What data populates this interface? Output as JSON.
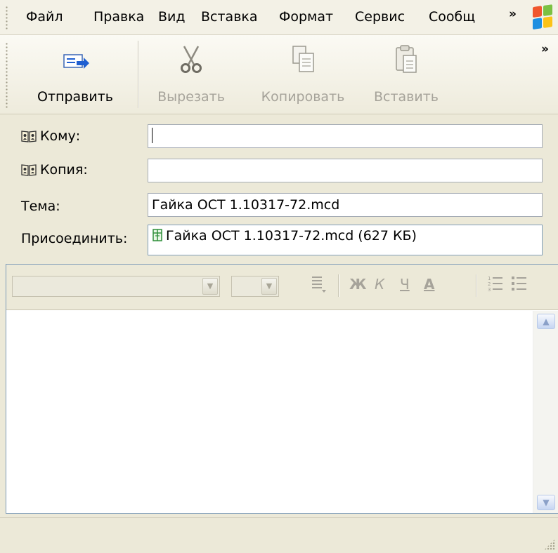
{
  "menu": {
    "items": [
      "Файл",
      "Правка",
      "Вид",
      "Вставка",
      "Формат",
      "Сервис",
      "Сообщ"
    ],
    "more_label": "»"
  },
  "toolbar": {
    "send_label": "Отправить",
    "cut_label": "Вырезать",
    "copy_label": "Копировать",
    "paste_label": "Вставить",
    "more_label": "»"
  },
  "header": {
    "to_label": "Кому:",
    "to_value": "",
    "cc_label": "Копия:",
    "cc_value": "",
    "subject_label": "Тема:",
    "subject_value": "Гайка ОСТ 1.10317-72.mcd",
    "attach_label": "Присоединить:",
    "attachment": "Гайка ОСТ 1.10317-72.mcd (627 КБ)"
  },
  "format": {
    "bold": "Ж",
    "italic": "К",
    "underline": "Ч",
    "font_color": "А",
    "font_name": "",
    "font_size": ""
  },
  "body_text": "",
  "colors": {
    "chrome": "#ece9d8",
    "field_border": "#7f9db9",
    "disabled_text": "#a6a39a",
    "send_icon_blue": "#1f5fd1"
  },
  "icons": [
    "send-icon",
    "cut-icon",
    "copy-icon",
    "paste-icon",
    "address-book-icon",
    "attachment-icon",
    "windows-logo-icon",
    "justify-icon",
    "numbered-list-icon",
    "bullet-list-icon",
    "scroll-up-icon",
    "scroll-down-icon",
    "resize-grip-icon"
  ]
}
